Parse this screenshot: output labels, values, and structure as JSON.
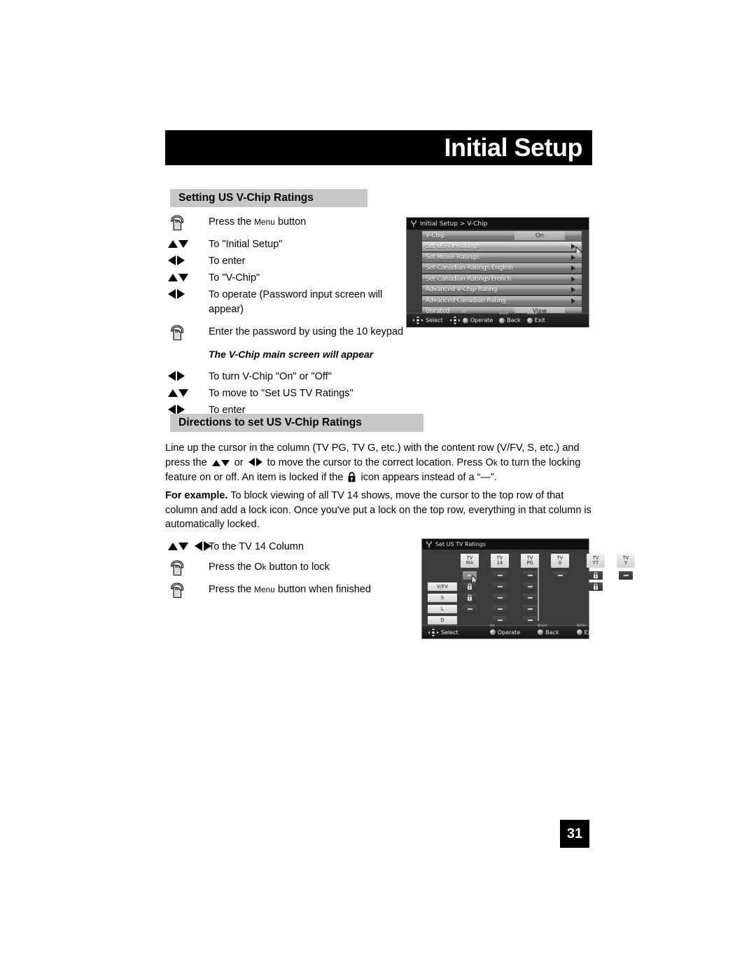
{
  "page": {
    "chapter_title": "Initial Setup",
    "page_number": "31"
  },
  "section1": {
    "heading": "Setting US V-Chip Ratings",
    "steps": [
      {
        "icon": "hand-press-icon",
        "text": "Press the ",
        "sc": "Menu",
        "text_after": " button"
      },
      {
        "icon": "up-down-arrows-icon",
        "text": "To \"Initial Setup\""
      },
      {
        "icon": "left-right-arrows-icon",
        "text": "To enter"
      },
      {
        "icon": "up-down-arrows-icon",
        "text": "To \"V-Chip\""
      },
      {
        "icon": "left-right-arrows-icon",
        "text": "To operate (Password input screen will appear)"
      },
      {
        "icon": "hand-press-icon",
        "text": "Enter the password by using the 10 keypad"
      },
      {
        "icon": "none",
        "text": "The V-Chip main screen will appear"
      },
      {
        "icon": "left-right-arrows-icon",
        "text": "To turn V-Chip \"On\" or \"Off\""
      },
      {
        "icon": "up-down-arrows-icon",
        "text": "To move to \"Set US TV Ratings\""
      },
      {
        "icon": "left-right-arrows-icon",
        "text": "To enter"
      }
    ]
  },
  "section2": {
    "heading": "Directions to set US V-Chip Ratings",
    "paragraph1_a": "Line up the cursor in the column (TV PG, TV G, etc.) with the content row (V/FV, S, etc.) and press the ",
    "paragraph1_b": " or ",
    "paragraph1_c": " to move the cursor to the correct location. Press O",
    "paragraph1_c_sc": "k",
    "paragraph1_d": " to turn the locking feature on or off. An item is locked if the ",
    "paragraph1_e": " icon appears instead of a “—”.",
    "paragraph2_bold": "For example.",
    "paragraph2": " To block viewing of all TV 14 shows, move the cursor to the top row of that column and add a lock icon. Once you've put a lock on the top row, everything in that column is automatically locked.",
    "steps": [
      {
        "icon": "up-down-left-right-arrows-icon",
        "text": "To the TV 14 Column"
      },
      {
        "icon": "hand-press-icon",
        "text": "Press the O",
        "sc": "k",
        "text_after": " button to lock"
      },
      {
        "icon": "hand-press-icon",
        "text": "Press the ",
        "sc": "Menu",
        "text_after": " button when finished"
      }
    ]
  },
  "osd_vchip": {
    "title": "Initial Setup > V-Chip",
    "title_icon": "tuning-fork-icon",
    "rows": [
      {
        "label": "V-Chip",
        "type": "value",
        "value": "On",
        "selected": false
      },
      {
        "label": "Set US TV Ratings",
        "type": "arrow",
        "selected": true
      },
      {
        "label": "Set Movie Ratings",
        "type": "arrow",
        "selected": false
      },
      {
        "label": "Set Canadian Ratings English",
        "type": "arrow",
        "selected": false
      },
      {
        "label": "Set Canadian Ratings French",
        "type": "arrow",
        "selected": false
      },
      {
        "label": "Advanced V-Chip Rating",
        "type": "arrow",
        "selected": false
      },
      {
        "label": "Advanced Canadian Rating",
        "type": "arrow",
        "selected": false
      },
      {
        "label": "Unrated",
        "type": "value",
        "value": "View",
        "selected": false
      }
    ],
    "footer": [
      {
        "icon": "dpad-icon",
        "cap": "",
        "label": "Select"
      },
      {
        "icon": "dpad-icon",
        "cap": "OK",
        "label": "Operate"
      },
      {
        "icon": "round-button-icon",
        "cap": "BACK",
        "label": "Back"
      },
      {
        "icon": "round-button-icon",
        "cap": "MENU",
        "label": "Exit"
      }
    ]
  },
  "osd_ratings": {
    "title": "Set US TV Ratings",
    "title_icon": "tuning-fork-icon",
    "columns": [
      "TV MA",
      "TV 14",
      "TV PG",
      "TV G",
      "TV Y7",
      "TV Y"
    ],
    "rows": [
      "",
      "V/FV",
      "S",
      "L",
      "D"
    ],
    "cells": [
      [
        "dash-selected",
        "dash",
        "dash",
        "dash",
        "lock",
        "dash"
      ],
      [
        "lock",
        "dash",
        "dash",
        "",
        "lock",
        ""
      ],
      [
        "lock",
        "dash",
        "dash",
        "",
        "",
        ""
      ],
      [
        "dash",
        "dash",
        "dash",
        "",
        "",
        ""
      ],
      [
        "",
        "dash",
        "dash",
        "",
        "",
        ""
      ]
    ],
    "footer": [
      {
        "icon": "dpad-icon",
        "cap": "",
        "label": "Select"
      },
      {
        "icon": "round-button-icon",
        "cap": "OK",
        "label": "Operate"
      },
      {
        "icon": "round-button-icon",
        "cap": "BACK",
        "label": "Back"
      },
      {
        "icon": "round-button-icon",
        "cap": "MENU",
        "label": "Exit"
      }
    ]
  },
  "colors": {
    "heading_bar": "#c8c8c8",
    "title_bar": "#000000",
    "osd_bg": "#3c3c3c"
  }
}
